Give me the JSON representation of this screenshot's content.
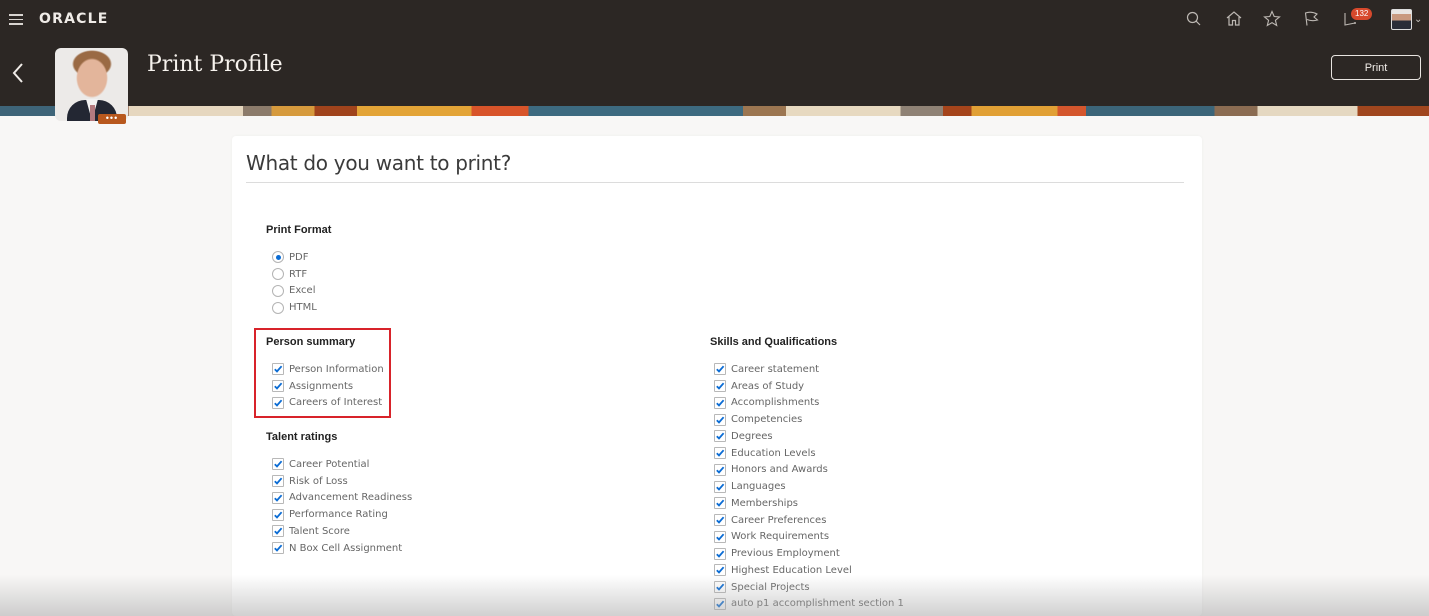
{
  "header": {
    "brand": "ORACLE",
    "notifications_count": "132",
    "icons": [
      "menu-icon",
      "search-icon",
      "home-icon",
      "favorites-star-icon",
      "flag-icon",
      "notifications-icon",
      "user-avatar",
      "chevron-down-icon"
    ]
  },
  "page": {
    "title": "Print Profile",
    "print_button": "Print",
    "more_label": "•••"
  },
  "card": {
    "title": "What do you want to print?",
    "print_format": {
      "label": "Print Format",
      "options": [
        {
          "label": "PDF",
          "selected": true
        },
        {
          "label": "RTF",
          "selected": false
        },
        {
          "label": "Excel",
          "selected": false
        },
        {
          "label": "HTML",
          "selected": false
        }
      ]
    },
    "person_summary": {
      "label": "Person summary",
      "items": [
        {
          "label": "Person Information",
          "checked": true
        },
        {
          "label": "Assignments",
          "checked": true
        },
        {
          "label": "Careers of Interest",
          "checked": true
        }
      ]
    },
    "talent_ratings": {
      "label": "Talent ratings",
      "items": [
        {
          "label": "Career Potential",
          "checked": true
        },
        {
          "label": "Risk of Loss",
          "checked": true
        },
        {
          "label": "Advancement Readiness",
          "checked": true
        },
        {
          "label": "Performance Rating",
          "checked": true
        },
        {
          "label": "Talent Score",
          "checked": true
        },
        {
          "label": "N Box Cell Assignment",
          "checked": true
        }
      ]
    },
    "skills_qualifications": {
      "label": "Skills and Qualifications",
      "items": [
        {
          "label": "Career statement",
          "checked": true
        },
        {
          "label": "Areas of Study",
          "checked": true
        },
        {
          "label": "Accomplishments",
          "checked": true
        },
        {
          "label": "Competencies",
          "checked": true
        },
        {
          "label": "Degrees",
          "checked": true
        },
        {
          "label": "Education Levels",
          "checked": true
        },
        {
          "label": "Honors and Awards",
          "checked": true
        },
        {
          "label": "Languages",
          "checked": true
        },
        {
          "label": "Memberships",
          "checked": true
        },
        {
          "label": "Career Preferences",
          "checked": true
        },
        {
          "label": "Work Requirements",
          "checked": true
        },
        {
          "label": "Previous Employment",
          "checked": true
        },
        {
          "label": "Highest Education Level",
          "checked": true
        },
        {
          "label": "Special Projects",
          "checked": true
        },
        {
          "label": "auto p1 accomplishment section 1",
          "checked": true
        }
      ]
    }
  },
  "colors": {
    "header_bg": "#2c2724",
    "accent_blue": "#0b6cd4",
    "badge_red": "#d7492c",
    "highlight_red": "#d8232a",
    "more_button": "#b8581d"
  }
}
